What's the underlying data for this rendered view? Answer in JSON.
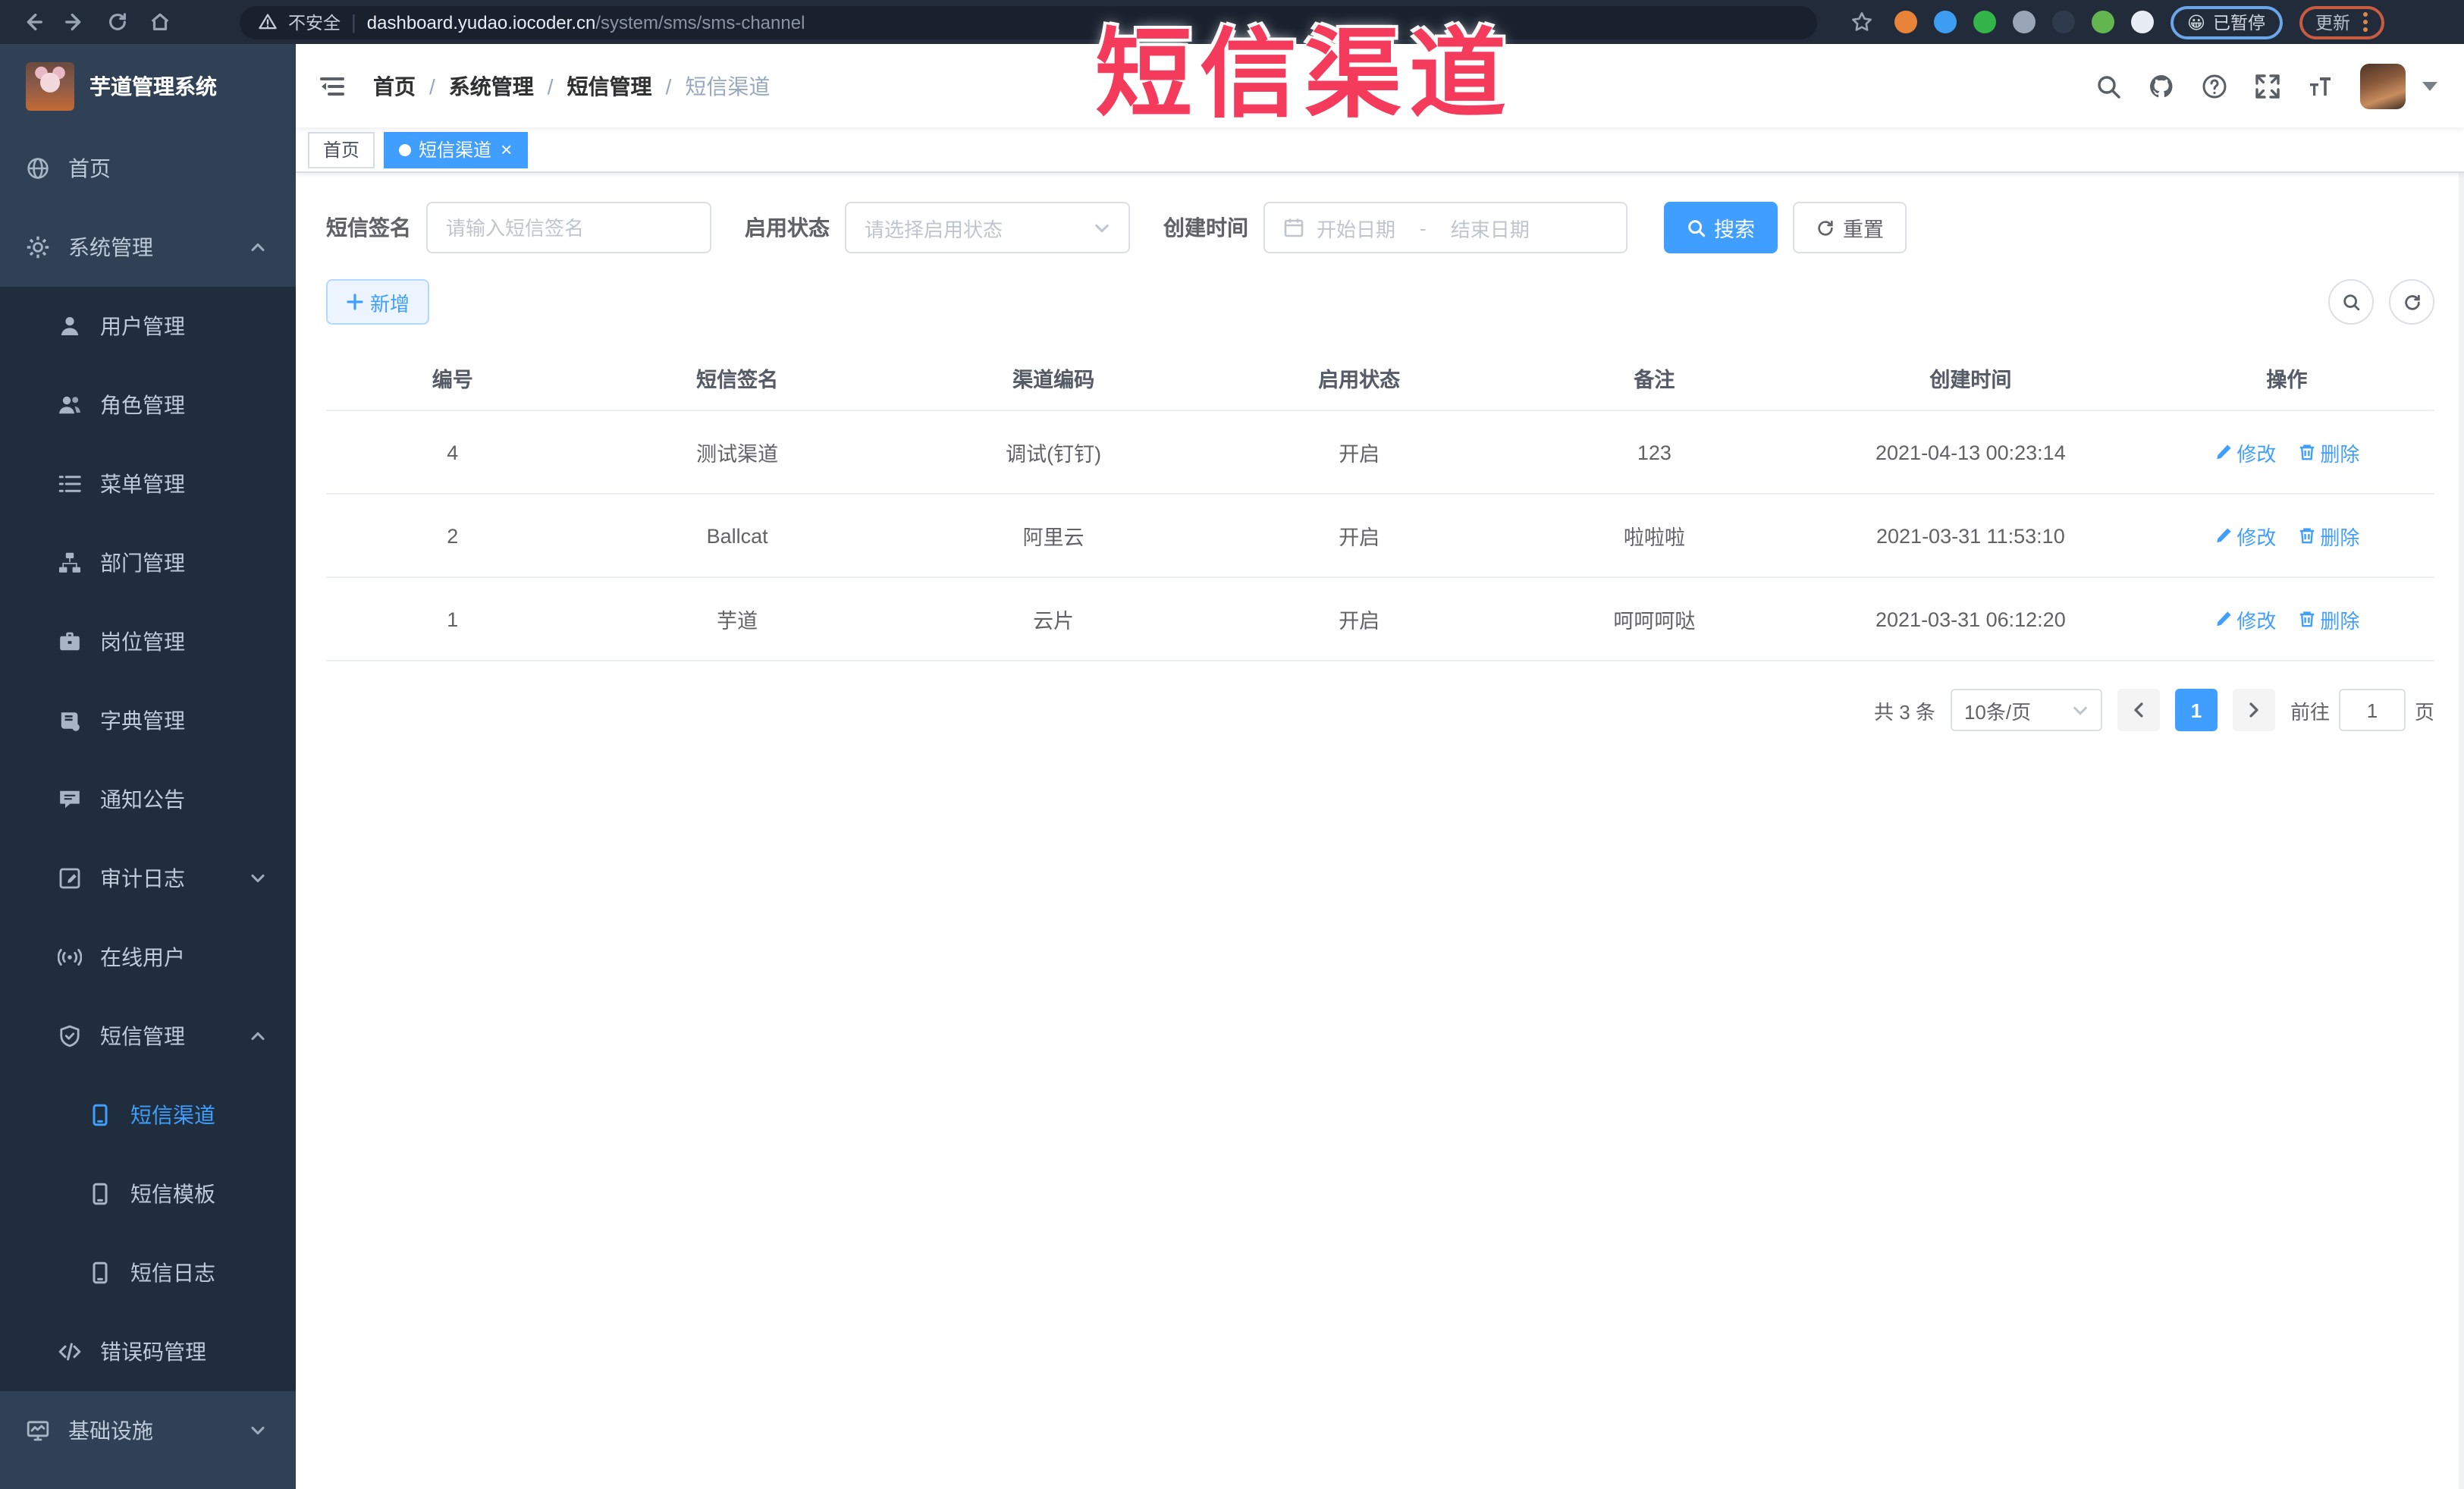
{
  "browser": {
    "security_label": "不安全",
    "url_domain": "dashboard.yudao.iocoder.cn",
    "url_path": "/system/sms/sms-channel",
    "paused_label": "已暂停",
    "paused_emoji": "😀",
    "update_label": "更新",
    "nav_icons": [
      "back-icon",
      "forward-icon",
      "reload-icon",
      "home-icon"
    ],
    "extensions": [
      {
        "name": "extension-orange-ring-icon",
        "color": "#e8833a"
      },
      {
        "name": "extension-blue-pin-icon",
        "color": "#3d9df3"
      },
      {
        "name": "extension-green-check-icon",
        "color": "#34b54a"
      },
      {
        "name": "extension-gray-people-icon",
        "color": "#9aa6b5"
      },
      {
        "name": "extension-dark-on-badge-icon",
        "color": "#2f3b4c"
      },
      {
        "name": "extension-green-sprout-icon",
        "color": "#63b54f"
      },
      {
        "name": "extension-white-puzzle-icon",
        "color": "#e8edf3"
      }
    ]
  },
  "annotation": {
    "title": "短信渠道"
  },
  "sidebar": {
    "app_title": "芋道管理系统",
    "items": [
      {
        "label": "首页",
        "icon": "home",
        "level": 0
      },
      {
        "label": "系统管理",
        "icon": "gear",
        "level": 0,
        "arrow": "up"
      },
      {
        "label": "用户管理",
        "icon": "user",
        "level": 1
      },
      {
        "label": "角色管理",
        "icon": "users",
        "level": 1
      },
      {
        "label": "菜单管理",
        "icon": "list",
        "level": 1
      },
      {
        "label": "部门管理",
        "icon": "tree",
        "level": 1
      },
      {
        "label": "岗位管理",
        "icon": "briefcase",
        "level": 1
      },
      {
        "label": "字典管理",
        "icon": "book",
        "level": 1
      },
      {
        "label": "通知公告",
        "icon": "message",
        "level": 1
      },
      {
        "label": "审计日志",
        "icon": "log",
        "level": 1,
        "arrow": "down"
      },
      {
        "label": "在线用户",
        "icon": "online",
        "level": 1
      },
      {
        "label": "短信管理",
        "icon": "shield",
        "level": 1,
        "arrow": "up"
      },
      {
        "label": "短信渠道",
        "icon": "phone",
        "level": 2,
        "active": true
      },
      {
        "label": "短信模板",
        "icon": "phone",
        "level": 2
      },
      {
        "label": "短信日志",
        "icon": "phone",
        "level": 2
      },
      {
        "label": "错误码管理",
        "icon": "code",
        "level": 1
      },
      {
        "label": "基础设施",
        "icon": "monitor",
        "level": 0,
        "arrow": "down"
      }
    ]
  },
  "navbar": {
    "breadcrumb": [
      "首页",
      "系统管理",
      "短信管理",
      "短信渠道"
    ],
    "right_icons": [
      "search-icon",
      "github-icon",
      "help-icon",
      "fullscreen-icon",
      "font-size-icon"
    ]
  },
  "tags": [
    {
      "label": "首页",
      "active": false,
      "closable": false
    },
    {
      "label": "短信渠道",
      "active": true,
      "closable": true
    }
  ],
  "filters": {
    "sign_label": "短信签名",
    "sign_placeholder": "请输入短信签名",
    "status_label": "启用状态",
    "status_placeholder": "请选择启用状态",
    "time_label": "创建时间",
    "start_placeholder": "开始日期",
    "range_separator": "-",
    "end_placeholder": "结束日期",
    "search_label": "搜索",
    "reset_label": "重置"
  },
  "toolbar": {
    "add_label": "新增"
  },
  "table": {
    "columns": [
      "编号",
      "短信签名",
      "渠道编码",
      "启用状态",
      "备注",
      "创建时间",
      "操作"
    ],
    "edit_label": "修改",
    "delete_label": "删除",
    "rows": [
      {
        "id": "4",
        "sign": "测试渠道",
        "code": "调试(钉钉)",
        "status": "开启",
        "remark": "123",
        "created": "2021-04-13 00:23:14"
      },
      {
        "id": "2",
        "sign": "Ballcat",
        "code": "阿里云",
        "status": "开启",
        "remark": "啦啦啦",
        "created": "2021-03-31 11:53:10"
      },
      {
        "id": "1",
        "sign": "芋道",
        "code": "云片",
        "status": "开启",
        "remark": "呵呵呵哒",
        "created": "2021-03-31 06:12:20"
      }
    ]
  },
  "pagination": {
    "total_label": "共 3 条",
    "page_size_label": "10条/页",
    "current_page": "1",
    "goto_label": "前往",
    "goto_value": "1",
    "page_unit_label": "页"
  },
  "colors": {
    "accent_blue": "#409eff",
    "sidebar_bg": "#304156",
    "submenu_bg": "#1f2d3d",
    "annotation_red": "#f43b5c",
    "active_tab_bg": "#409eff"
  }
}
